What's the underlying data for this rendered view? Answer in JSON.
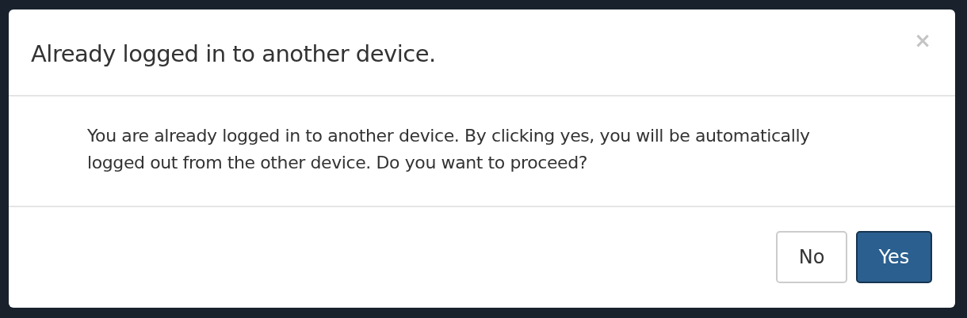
{
  "dialog": {
    "title": "Already logged in to another device.",
    "close": "×",
    "message": "You are already logged in to another device. By clicking yes, you will be automatically logged out from the other device. Do you want to proceed?",
    "buttons": [
      {
        "label": "No",
        "kind": "default"
      },
      {
        "label": "Yes",
        "kind": "primary"
      }
    ]
  }
}
